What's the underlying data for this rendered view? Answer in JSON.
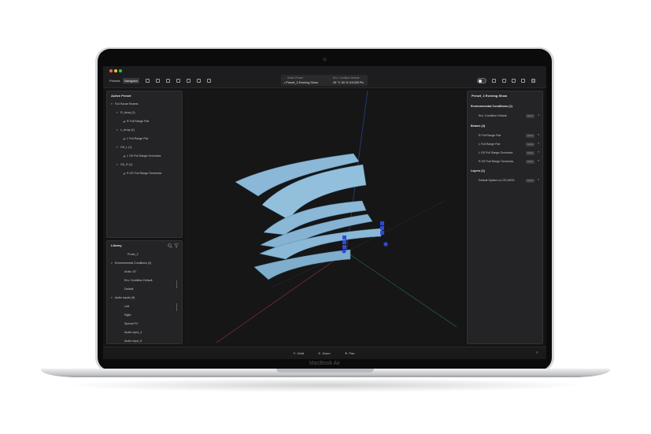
{
  "device": {
    "label": "MacBook Air"
  },
  "toolbar": {
    "tabs": [
      {
        "label": "Presets"
      },
      {
        "label": "Navigator"
      }
    ],
    "active_preset_label": "Active Preset",
    "active_preset_value": "• Preset_2 Evening Show",
    "condition_label": "Env. Condition Default",
    "condition_value": "25 °C 50 % 101325 Pa"
  },
  "left_top": {
    "title": "Active Preset",
    "rows": [
      {
        "glyph": "▾",
        "label": "Full House Beams"
      },
      {
        "glyph": "▾",
        "label": "R_Array (1)"
      },
      {
        "glyph": "◢",
        "label": "R Full Range Flat"
      },
      {
        "glyph": "▾",
        "label": "L_Array (1)"
      },
      {
        "glyph": "◢",
        "label": "L Full Range Flat"
      },
      {
        "glyph": "▾",
        "label": "GS_L (1)"
      },
      {
        "glyph": "◢",
        "label": "L GS Full Range Orchestra"
      },
      {
        "glyph": "▾",
        "label": "GS_R (1)"
      },
      {
        "glyph": "◢",
        "label": "R GS Full Range Orchestra"
      }
    ]
  },
  "library": {
    "title": "Library",
    "rows": [
      {
        "glyph": "",
        "label": "Probe_2"
      },
      {
        "glyph": "▾",
        "label": "Environmental Conditions (3)"
      },
      {
        "glyph": "",
        "label": "Arctic 10°"
      },
      {
        "glyph": "",
        "label": "Env. Condition Default"
      },
      {
        "glyph": "",
        "label": "Default"
      },
      {
        "glyph": "▾",
        "label": "Audio Inputs (5)"
      },
      {
        "glyph": "",
        "label": "Left"
      },
      {
        "glyph": "",
        "label": "Right"
      },
      {
        "glyph": "",
        "label": "Special FX"
      },
      {
        "glyph": "",
        "label": "Audio Input_4"
      },
      {
        "glyph": "",
        "label": "Audio Input_5"
      }
    ]
  },
  "right": {
    "title": "Preset_2 Evening Show",
    "sections": [
      {
        "label": "Environmental Conditions (1)",
        "items": [
          "Env. Condition Default"
        ]
      },
      {
        "label": "Beams (4)",
        "items": [
          "R Full Range Flat",
          "L Full Range Flat",
          "L GS Full Range Orchestra",
          "R GS Full Range Orchestra"
        ]
      },
      {
        "label": "Layers (1)",
        "items": [
          "Default System no GS AES2"
        ]
      }
    ],
    "pill_text": "Active"
  },
  "bottom": {
    "items": [
      {
        "label": "Orbit"
      },
      {
        "label": "Zoom"
      },
      {
        "label": "Pan"
      }
    ]
  },
  "colors": {
    "beam": "#8ab8d6",
    "speaker": "#2d4bd8",
    "axis_x": "#b53a3a",
    "axis_y": "#2f8a4c",
    "axis_z": "#3b5bd0"
  }
}
